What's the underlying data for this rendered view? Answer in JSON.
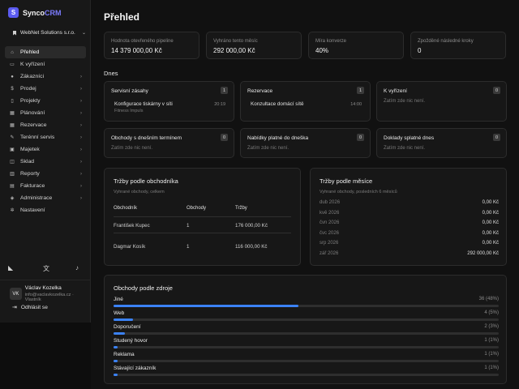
{
  "app": {
    "logo_letter": "S",
    "name_part1": "Synco",
    "name_part2": "CRM",
    "accent": "#5b5bf0"
  },
  "org": {
    "name": "WebNet Solutions s.r.o."
  },
  "nav": [
    {
      "label": "Přehled",
      "icon": "home-icon",
      "active": true,
      "chevron": false
    },
    {
      "label": "K vyřízení",
      "icon": "inbox-icon",
      "active": false,
      "chevron": false
    },
    {
      "label": "Zákazníci",
      "icon": "users-icon",
      "active": false,
      "chevron": true
    },
    {
      "label": "Prodej",
      "icon": "dollar-icon",
      "active": false,
      "chevron": true
    },
    {
      "label": "Projekty",
      "icon": "folder-icon",
      "active": false,
      "chevron": true
    },
    {
      "label": "Plánování",
      "icon": "calendar-icon",
      "active": false,
      "chevron": true
    },
    {
      "label": "Rezervace",
      "icon": "calendar-check-icon",
      "active": false,
      "chevron": true
    },
    {
      "label": "Terénní servis",
      "icon": "wrench-icon",
      "active": false,
      "chevron": true
    },
    {
      "label": "Majetek",
      "icon": "briefcase-icon",
      "active": false,
      "chevron": true
    },
    {
      "label": "Sklad",
      "icon": "box-icon",
      "active": false,
      "chevron": true
    },
    {
      "label": "Reporty",
      "icon": "chart-icon",
      "active": false,
      "chevron": true
    },
    {
      "label": "Fakturace",
      "icon": "invoice-icon",
      "active": false,
      "chevron": true
    },
    {
      "label": "Administrace",
      "icon": "shield-icon",
      "active": false,
      "chevron": true
    },
    {
      "label": "Nastavení",
      "icon": "gear-icon",
      "active": false,
      "chevron": false
    }
  ],
  "user": {
    "initials": "VK",
    "name": "Václav Kozelka",
    "email": "info@vaclavkozelka.cz",
    "role": "Vlastník",
    "logout_label": "Odhlásit se"
  },
  "page": {
    "title": "Přehled"
  },
  "kpis": [
    {
      "label": "Hodnota otevřeného pipeline",
      "value": "14 379 000,00 Kč"
    },
    {
      "label": "Vyhráno tento měsíc",
      "value": "292 000,00 Kč"
    },
    {
      "label": "Míra konverze",
      "value": "40%"
    },
    {
      "label": "Zpožděné následné kroky",
      "value": "0"
    }
  ],
  "today": {
    "title": "Dnes",
    "empty_text": "Zatím zde nic není.",
    "cards": [
      {
        "title": "Servisní zásahy",
        "count": "1",
        "item": {
          "title": "Konfigurace tiskárny v síti",
          "sub": "Fitness Impuls",
          "time": "20:19"
        }
      },
      {
        "title": "Rezervace",
        "count": "1",
        "item": {
          "title": "Konzultace domácí sítě",
          "sub": "",
          "time": "14:00"
        }
      },
      {
        "title": "K vyřízení",
        "count": "0",
        "item": null
      },
      {
        "title": "Obchody s dnešním termínem",
        "count": "0",
        "item": null
      },
      {
        "title": "Nabídky platné do dneška",
        "count": "0",
        "item": null
      },
      {
        "title": "Doklady splatné dnes",
        "count": "0",
        "item": null
      }
    ]
  },
  "sales_by_rep": {
    "title": "Tržby podle obchodníka",
    "subtitle": "Vyhrané obchody, celkem",
    "columns": [
      "Obchodník",
      "Obchody",
      "Tržby"
    ],
    "rows": [
      [
        "František Kupec",
        "1",
        "176 000,00 Kč"
      ],
      [
        "Dagmar Kosík",
        "1",
        "116 000,00 Kč"
      ]
    ]
  },
  "sales_by_month": {
    "title": "Tržby podle měsíce",
    "subtitle": "Vyhrané obchody, posledních 6 měsíců",
    "rows": [
      {
        "month": "dub 2026",
        "value": "0,00 Kč"
      },
      {
        "month": "kvě 2026",
        "value": "0,00 Kč"
      },
      {
        "month": "čvn 2026",
        "value": "0,00 Kč"
      },
      {
        "month": "čvc 2026",
        "value": "0,00 Kč"
      },
      {
        "month": "srp 2026",
        "value": "0,00 Kč"
      },
      {
        "month": "zář 2026",
        "value": "292 000,00 Kč"
      }
    ]
  },
  "deals_by_source": {
    "title": "Obchody podle zdroje",
    "bar_color": "#3b82f6",
    "rows": [
      {
        "label": "Jiné",
        "value": "36 (48%)",
        "share": 0.48
      },
      {
        "label": "Web",
        "value": "4 (5%)",
        "share": 0.05
      },
      {
        "label": "Doporučení",
        "value": "2 (3%)",
        "share": 0.03
      },
      {
        "label": "Studený hovor",
        "value": "1 (1%)",
        "share": 0.01
      },
      {
        "label": "Reklama",
        "value": "1 (1%)",
        "share": 0.01
      },
      {
        "label": "Stávající zákazník",
        "value": "1 (1%)",
        "share": 0.01
      }
    ]
  }
}
